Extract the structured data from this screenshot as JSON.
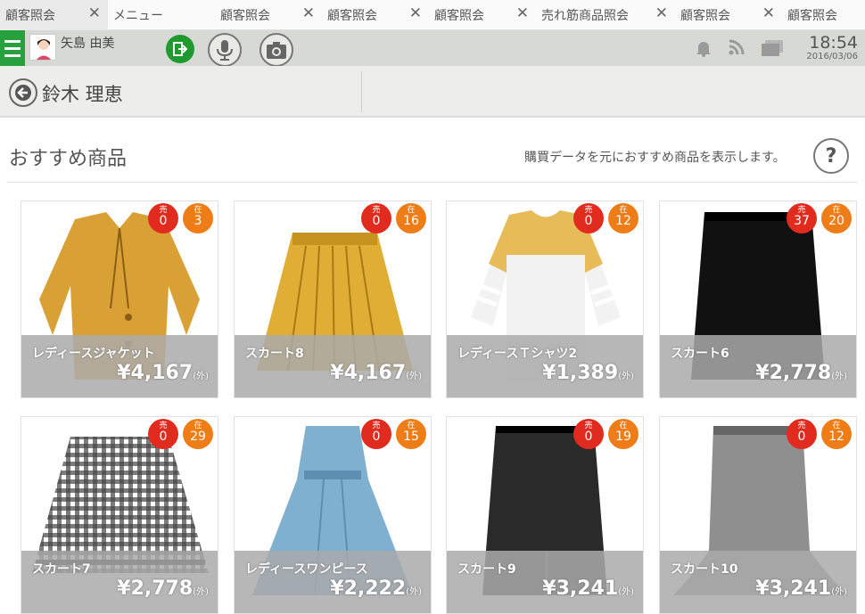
{
  "tabs": [
    {
      "label": "顧客照会",
      "closable": true
    },
    {
      "label": "メニュー",
      "closable": false
    },
    {
      "label": "顧客照会",
      "closable": true
    },
    {
      "label": "顧客照会",
      "closable": true
    },
    {
      "label": "顧客照会",
      "closable": true
    },
    {
      "label": "売れ筋商品照会",
      "closable": true
    },
    {
      "label": "顧客照会",
      "closable": true
    },
    {
      "label": "顧客照会",
      "closable": false
    }
  ],
  "close_glyph": "✕",
  "header": {
    "user": "矢島 由美",
    "time": "18:54",
    "date": "2016/03/06"
  },
  "customer": {
    "name": "鈴木 理恵"
  },
  "section": {
    "title": "おすすめ商品",
    "description": "購買データを元におすすめ商品を表示します。",
    "help": "?"
  },
  "badge_labels": {
    "sold": "売",
    "stock": "在"
  },
  "tax_label": "(外)",
  "products": [
    {
      "name": "レディースジャケット",
      "price": "¥4,167",
      "sold": "0",
      "stock": "3",
      "color": "#d9a035",
      "icon": "jacket-icon"
    },
    {
      "name": "スカート8",
      "price": "¥4,167",
      "sold": "0",
      "stock": "16",
      "color": "#e0ad35",
      "icon": "pleated-skirt-icon"
    },
    {
      "name": "レディースＴシャツ2",
      "price": "¥1,389",
      "sold": "0",
      "stock": "12",
      "color": "#e7b548",
      "icon": "tshirt-icon"
    },
    {
      "name": "スカート6",
      "price": "¥2,778",
      "sold": "37",
      "stock": "20",
      "color": "#111111",
      "icon": "pencil-skirt-icon"
    },
    {
      "name": "スカート7",
      "price": "¥2,778",
      "sold": "0",
      "stock": "29",
      "color": "#444444",
      "icon": "gingham-skirt-icon"
    },
    {
      "name": "レディースワンピース",
      "price": "¥2,222",
      "sold": "0",
      "stock": "15",
      "color": "#7fb0cf",
      "icon": "dress-icon"
    },
    {
      "name": "スカート9",
      "price": "¥3,241",
      "sold": "0",
      "stock": "19",
      "color": "#2a2a2a",
      "icon": "slit-skirt-icon"
    },
    {
      "name": "スカート10",
      "price": "¥3,241",
      "sold": "0",
      "stock": "12",
      "color": "#8f8f8f",
      "icon": "flare-skirt-icon"
    }
  ]
}
